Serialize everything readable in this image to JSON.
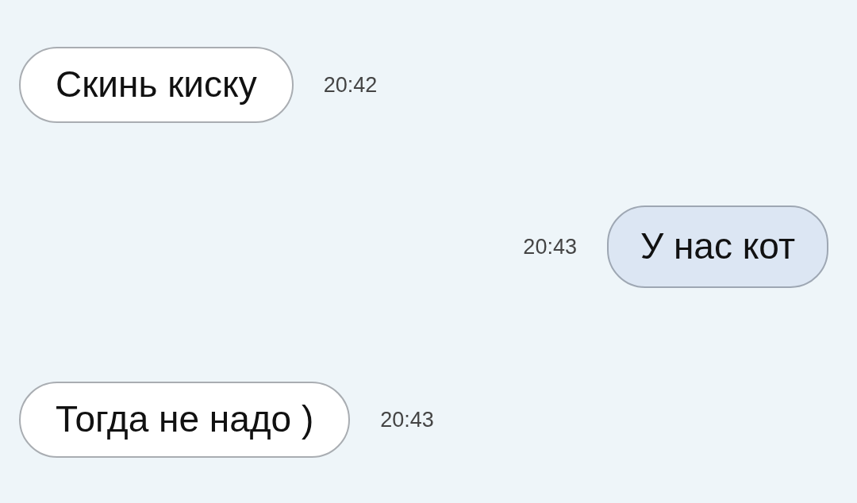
{
  "messages": [
    {
      "kind": "incoming",
      "text": "Скинь киску",
      "time": "20:42"
    },
    {
      "kind": "outgoing",
      "text": "У нас кот",
      "time": "20:43"
    },
    {
      "kind": "incoming",
      "text": "Тогда не надо )",
      "time": "20:43"
    }
  ]
}
